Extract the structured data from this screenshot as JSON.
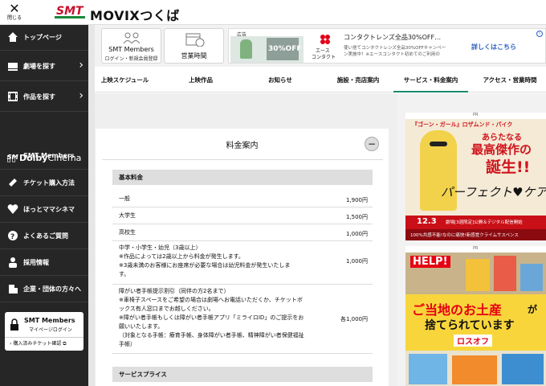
{
  "header": {
    "close_label": "閉じる",
    "logo_text": "SMT",
    "brand": "MOVIXつくば"
  },
  "sidebar": {
    "items": [
      {
        "label": "トップページ",
        "icon": "home-icon"
      },
      {
        "label": "劇場を探す",
        "icon": "theater-icon"
      },
      {
        "label": "作品を探す",
        "icon": "film-icon"
      },
      {
        "label": "SMT Members",
        "icon": "smt-icon"
      },
      {
        "label": "チケット購入方法",
        "icon": "ticket-icon"
      },
      {
        "label": "ほっとママシネマ",
        "icon": "heart-icon"
      },
      {
        "label": "よくあるご質問",
        "icon": "question-icon"
      },
      {
        "label": "採用情報",
        "icon": "person-icon"
      },
      {
        "label": "企業・団体の方々へ",
        "icon": "building-icon"
      }
    ],
    "dolby_a": "Dolby",
    "dolby_b": "Cinema",
    "members_box": {
      "title": "SMT Members",
      "subtitle": "マイページログイン",
      "link": "購入済みチケット確認"
    }
  },
  "promo": {
    "members_title": "SMT Members",
    "members_sub": "ログイン・新規会員登録",
    "hours": "営業時間"
  },
  "top_ad": {
    "badge": "広告",
    "sale": "30%OFF",
    "brand_a": "エース",
    "brand_b": "コンタクト",
    "headline": "コンタクトレンズ全品30%OFF…",
    "body": "使い捨てコンタクトレンズ全品30%OFFキャンペーン実施中！※エースコンタクト初めてのご利用の",
    "cta": "詳しくはこちら",
    "info": "i"
  },
  "tabs": [
    {
      "label": "上映スケジュール",
      "active": false
    },
    {
      "label": "上映作品",
      "active": false
    },
    {
      "label": "お知らせ",
      "active": false
    },
    {
      "label": "施設・売店案内",
      "active": false
    },
    {
      "label": "サービス・料金案内",
      "active": true
    },
    {
      "label": "アクセス・営業時間",
      "active": false
    }
  ],
  "card": {
    "title": "料金案内",
    "collapse": "−",
    "section_basic": "基本料金",
    "section_service": "サービスプライス",
    "rows": [
      {
        "lines": [
          "一般"
        ],
        "price": "1,900円"
      },
      {
        "lines": [
          "大学生"
        ],
        "price": "1,500円"
      },
      {
        "lines": [
          "高校生"
        ],
        "price": "1,000円"
      },
      {
        "lines": [
          "中学・小学生・幼児（3歳以上）",
          "※作品によっては2歳以上から料金が発生します。",
          "※3歳未満のお客様にお座席が必要な場合は幼児料金が発生いたしま",
          "す。"
        ],
        "price": "1,000円"
      },
      {
        "lines": [
          "障がい者手帳提示割引（同伴の方2名まで）",
          "※車椅子スペースをご希望の場合は劇場へお電話いただくか、チケットボ",
          "ックス有人窓口までお越しください。",
          "※障がい者手帳もしくは障がい者手帳アプリ「ミライロID」のご提示をお",
          "願いいたします。",
          "（対象となる手帳：療育手帳、身体障がい者手帳、精神障がい者保健福祉",
          "手帳）"
        ],
        "price": "各1,000円"
      }
    ]
  },
  "ad1": {
    "pr": "PR",
    "top_line": "『ゴーン・ガール』ロザムンド・パイク",
    "l1": "あらたなる",
    "l2": "最高傑作の",
    "l3": "誕生!!",
    "title": "パーフェクト♥ケア",
    "release": "12.3",
    "release_sub": "劇場[3週限定]公開＆デジタル配信開始",
    "bottom": "100%共感不能!なのに痛快!新感覚クライムサスペンス"
  },
  "ad2": {
    "pr": "PR",
    "help": "HELP!",
    "l1": "ご当地のお土産",
    "l2": "が",
    "l3": "捨てられています",
    "brand": "ロスオフ"
  },
  "colors": {
    "sidebar": "#262626",
    "accent": "#1a8a6d",
    "ad_link": "#2b5fc2",
    "ad1_red": "#d0141c",
    "ad2_red": "#e60012"
  }
}
